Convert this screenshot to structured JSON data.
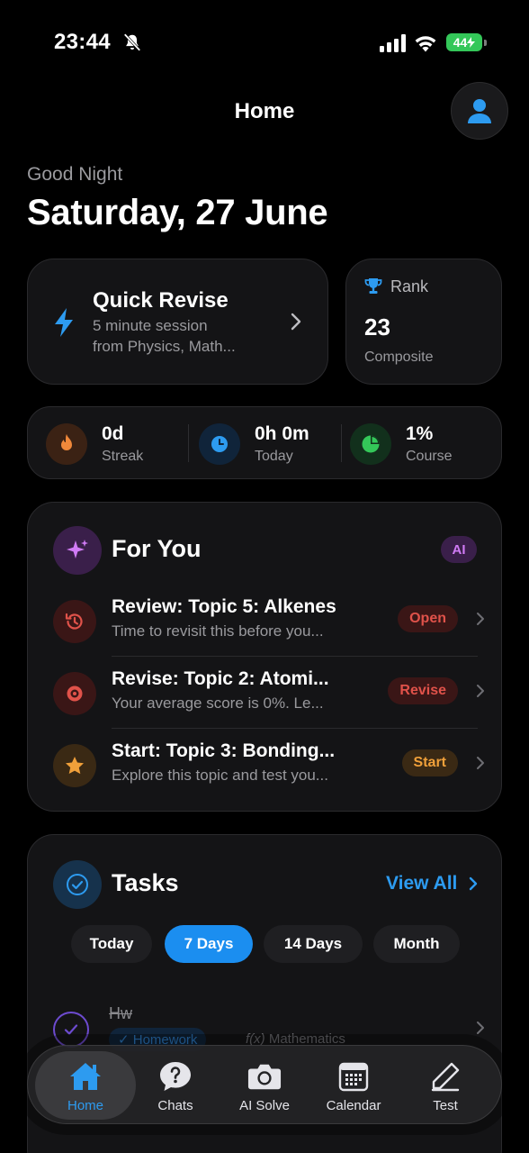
{
  "status_bar": {
    "time": "23:44",
    "battery": "44"
  },
  "nav": {
    "title": "Home"
  },
  "greeting": "Good Night",
  "date": "Saturday, 27 June",
  "quick_revise": {
    "title": "Quick Revise",
    "line1": "5 minute session",
    "line2": "from Physics, Math..."
  },
  "rank": {
    "label": "Rank",
    "value": "23",
    "sub": "Composite"
  },
  "stats": [
    {
      "value": "0d",
      "label": "Streak",
      "icon": "flame-icon",
      "color": "#f0883a"
    },
    {
      "value": "0h 0m",
      "label": "Today",
      "icon": "clock-icon",
      "color": "#2d9bf0"
    },
    {
      "value": "1%",
      "label": "Course",
      "icon": "pie-chart-icon",
      "color": "#34c759"
    }
  ],
  "for_you": {
    "title": "For You",
    "badge": "AI",
    "items": [
      {
        "title": "Review: Topic 5: Alkenes",
        "subtitle": "Time to revisit this before you...",
        "action": "Open",
        "icon": "history-icon",
        "color": "#e0524a"
      },
      {
        "title": "Revise: Topic 2: Atomi...",
        "subtitle": "Your average score is 0%. Le...",
        "action": "Revise",
        "icon": "target-icon",
        "color": "#e0524a"
      },
      {
        "title": "Start: Topic 3: Bonding...",
        "subtitle": "Explore this topic and test you...",
        "action": "Start",
        "icon": "star-icon",
        "color": "#f0a03a"
      }
    ]
  },
  "tasks": {
    "title": "Tasks",
    "view_all": "View All",
    "filters": [
      "Today",
      "7 Days",
      "14 Days",
      "Month"
    ],
    "active_filter": "7 Days",
    "items": [
      {
        "name": "Hw",
        "tag": "Homework",
        "subject": "Mathematics"
      }
    ]
  },
  "tab_bar": [
    {
      "label": "Home",
      "icon": "home-icon",
      "active": true
    },
    {
      "label": "Chats",
      "icon": "help-bubble-icon",
      "active": false
    },
    {
      "label": "AI Solve",
      "icon": "camera-icon",
      "active": false
    },
    {
      "label": "Calendar",
      "icon": "calendar-icon",
      "active": false
    },
    {
      "label": "Test",
      "icon": "pencil-icon",
      "active": false
    }
  ]
}
